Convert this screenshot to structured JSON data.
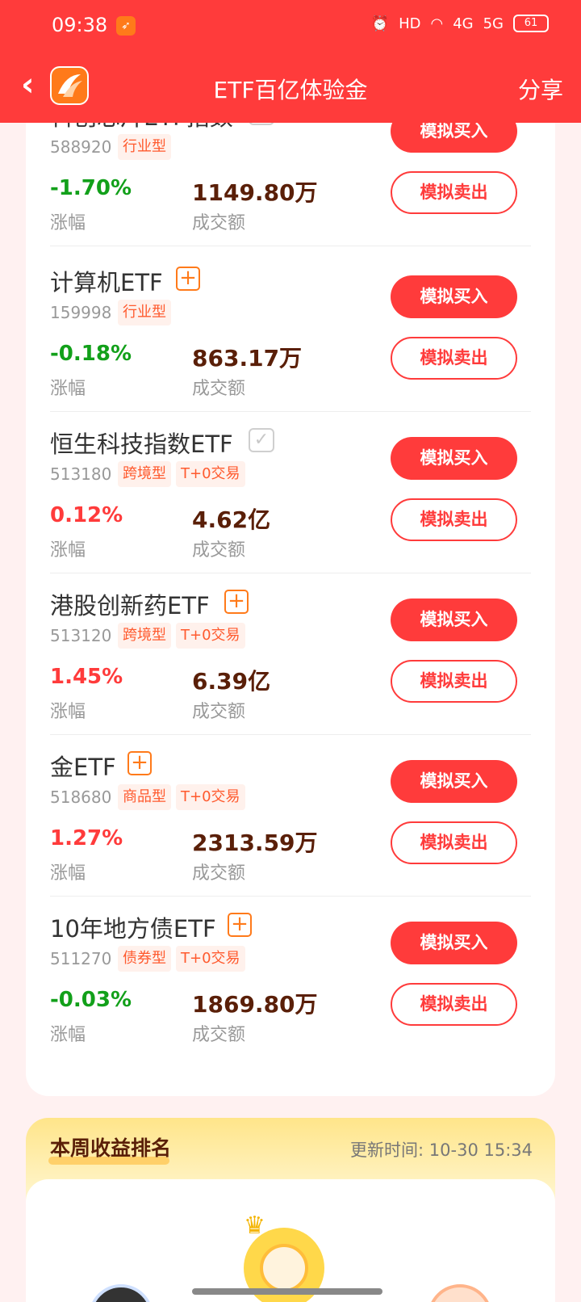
{
  "status_bar": {
    "time": "09:38",
    "hd": "HD",
    "net4g": "4G",
    "net5g": "5G",
    "battery": "61"
  },
  "header": {
    "back_icon": "chevron-left-icon",
    "title": "ETF百亿体验金",
    "share": "分享"
  },
  "labels": {
    "change": "涨幅",
    "volume": "成交额",
    "buy": "模拟买入",
    "sell": "模拟卖出"
  },
  "items": [
    {
      "name": "科创芯片ETF指数",
      "code": "588920",
      "tags": [
        "行业型"
      ],
      "change": "-1.70%",
      "volume": "1149.80万",
      "watched": true
    },
    {
      "name": "计算机ETF",
      "code": "159998",
      "tags": [
        "行业型"
      ],
      "change": "-0.18%",
      "volume": "863.17万",
      "watched": false
    },
    {
      "name": "恒生科技指数ETF",
      "code": "513180",
      "tags": [
        "跨境型",
        "T+0交易"
      ],
      "change": "0.12%",
      "volume": "4.62亿",
      "watched": true
    },
    {
      "name": "港股创新药ETF",
      "code": "513120",
      "tags": [
        "跨境型",
        "T+0交易"
      ],
      "change": "1.45%",
      "volume": "6.39亿",
      "watched": false
    },
    {
      "name": "金ETF",
      "code": "518680",
      "tags": [
        "商品型",
        "T+0交易"
      ],
      "change": "1.27%",
      "volume": "2313.59万",
      "watched": false
    },
    {
      "name": "10年地方债ETF",
      "code": "511270",
      "tags": [
        "债券型",
        "T+0交易"
      ],
      "change": "-0.03%",
      "volume": "1869.80万",
      "watched": false
    }
  ],
  "ranking": {
    "title": "本周收益排名",
    "update_time": "更新时间: 10-30 15:34"
  },
  "colors": {
    "brand": "#ff3b3b",
    "down": "#12a01a",
    "up": "#ff3b3b",
    "volume": "#5a1f08"
  }
}
